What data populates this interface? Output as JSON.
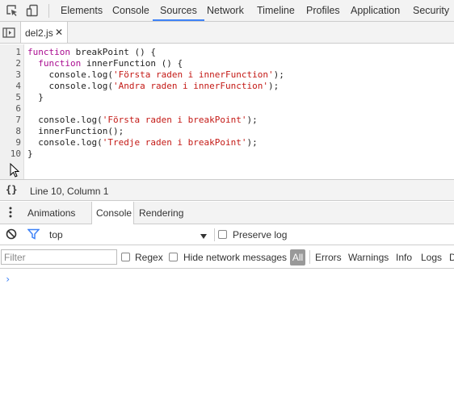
{
  "toolbar": {
    "tabs": [
      {
        "label": "Elements"
      },
      {
        "label": "Console"
      },
      {
        "label": "Sources"
      },
      {
        "label": "Network"
      },
      {
        "label": "Timeline"
      },
      {
        "label": "Profiles"
      },
      {
        "label": "Application"
      },
      {
        "label": "Security"
      }
    ],
    "selected_tab": "Sources",
    "accent_color": "#3e82f7",
    "icons": [
      "inspect-element-icon",
      "device-mode-icon"
    ]
  },
  "editor": {
    "open_file": "del2.js",
    "close_glyph": "✕",
    "sidebar_toggle_icon": "navigator-toggle-icon",
    "lines": [
      {
        "n": "1",
        "tokens": [
          {
            "t": "kw",
            "v": "function"
          },
          {
            "t": "plain",
            "v": " breakPoint () {"
          }
        ]
      },
      {
        "n": "2",
        "tokens": [
          {
            "t": "plain",
            "v": "  "
          },
          {
            "t": "kw",
            "v": "function"
          },
          {
            "t": "plain",
            "v": " innerFunction () {"
          }
        ]
      },
      {
        "n": "3",
        "tokens": [
          {
            "t": "plain",
            "v": "    console.log("
          },
          {
            "t": "str",
            "v": "'Första raden i innerFunction'"
          },
          {
            "t": "plain",
            "v": ");"
          }
        ]
      },
      {
        "n": "4",
        "tokens": [
          {
            "t": "plain",
            "v": "    console.log("
          },
          {
            "t": "str",
            "v": "'Andra raden i innerFunction'"
          },
          {
            "t": "plain",
            "v": ");"
          }
        ]
      },
      {
        "n": "5",
        "tokens": [
          {
            "t": "plain",
            "v": "  }"
          }
        ]
      },
      {
        "n": "6",
        "tokens": []
      },
      {
        "n": "7",
        "tokens": [
          {
            "t": "plain",
            "v": "  console.log("
          },
          {
            "t": "str",
            "v": "'Första raden i breakPoint'"
          },
          {
            "t": "plain",
            "v": ");"
          }
        ]
      },
      {
        "n": "8",
        "tokens": [
          {
            "t": "plain",
            "v": "  innerFunction();"
          }
        ]
      },
      {
        "n": "9",
        "tokens": [
          {
            "t": "plain",
            "v": "  console.log("
          },
          {
            "t": "str",
            "v": "'Tredje raden i breakPoint'"
          },
          {
            "t": "plain",
            "v": ");"
          }
        ]
      },
      {
        "n": "10",
        "tokens": [
          {
            "t": "plain",
            "v": "}"
          }
        ]
      }
    ]
  },
  "status": {
    "pretty_print": "{}",
    "position": "Line 10, Column 1"
  },
  "drawer": {
    "tabs": [
      {
        "label": "Animations"
      },
      {
        "label": "Console"
      },
      {
        "label": "Rendering"
      }
    ],
    "selected_tab": "Console"
  },
  "console_toolbar": {
    "context": "top",
    "preserve_log_label": "Preserve log",
    "filter_placeholder": "Filter",
    "regex_label": "Regex",
    "hide_network_label": "Hide network messages",
    "levels": {
      "all": "All",
      "errors": "Errors",
      "warnings": "Warnings",
      "info": "Info",
      "logs": "Logs",
      "debug_partial": "D"
    }
  },
  "console": {
    "prompt": "›"
  }
}
